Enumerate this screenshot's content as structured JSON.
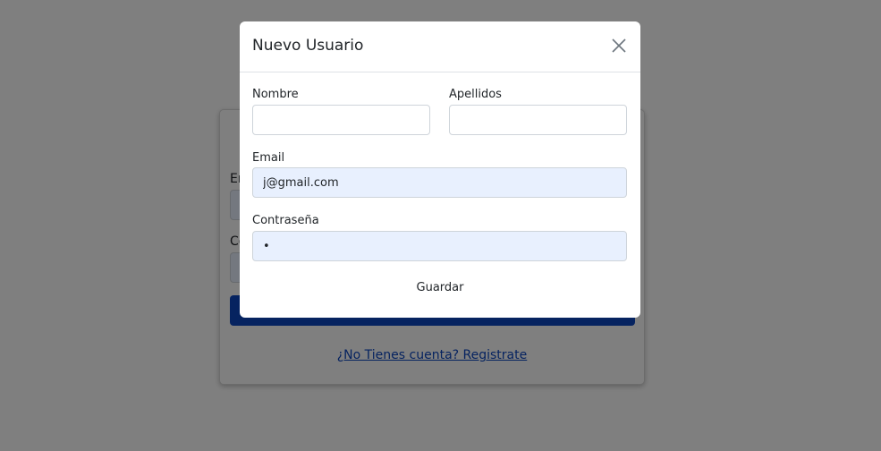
{
  "background": {
    "login": {
      "email_label_fragment": "En",
      "password_label_fragment": "Co",
      "register_link": "¿No Tienes cuenta? Registrate"
    }
  },
  "modal": {
    "title": "Nuevo Usuario",
    "close_icon": "close-icon",
    "fields": {
      "first_name": {
        "label": "Nombre",
        "value": ""
      },
      "last_name": {
        "label": "Apellidos",
        "value": ""
      },
      "email": {
        "label": "Email",
        "value": "j@gmail.com"
      },
      "password": {
        "label": "Contraseña",
        "value": "•"
      }
    },
    "save_label": "Guardar"
  },
  "colors": {
    "backdrop": "#808080",
    "autofill": "#e8f0fe",
    "primary": "#0d47c0"
  }
}
